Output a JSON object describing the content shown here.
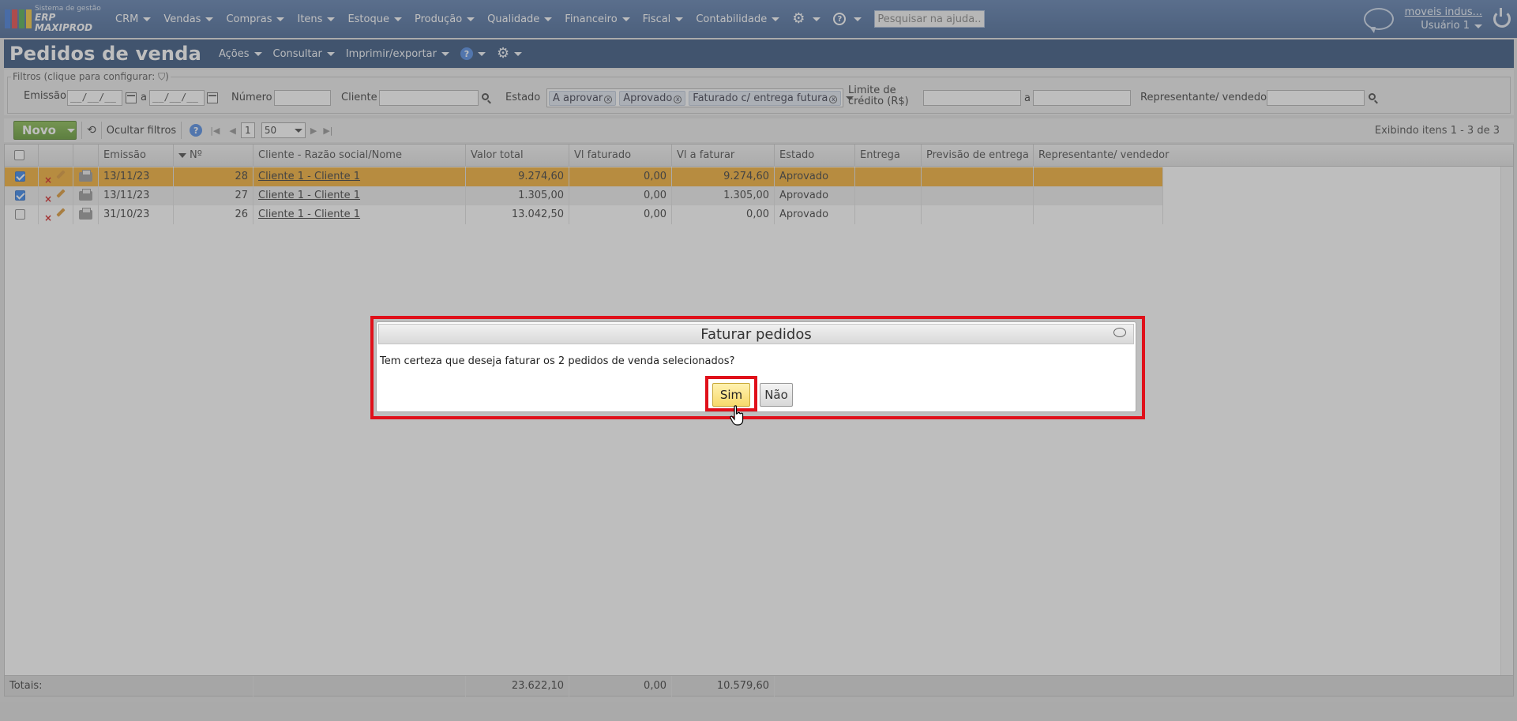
{
  "topbar": {
    "logo_line1": "Sistema de gestão",
    "logo_line2": "ERP MAXIPROD",
    "menu": [
      "CRM",
      "Vendas",
      "Compras",
      "Itens",
      "Estoque",
      "Produção",
      "Qualidade",
      "Financeiro",
      "Fiscal",
      "Contabilidade"
    ],
    "search_placeholder": "Pesquisar na ajuda...",
    "company": "moveis indus...",
    "user": "Usuário 1"
  },
  "page": {
    "title": "Pedidos de venda",
    "actions": [
      "Ações",
      "Consultar",
      "Imprimir/exportar"
    ]
  },
  "filters": {
    "legend": "Filtros (clique para configurar:",
    "emissao_label": "Emissão",
    "date_from": "__/__/__",
    "date_to": "__/__/__",
    "a_label": "a",
    "numero_label": "Número",
    "cliente_label": "Cliente",
    "estado_label": "Estado",
    "estado_tags": [
      "A aprovar",
      "Aprovado",
      "Faturado c/ entrega futura"
    ],
    "limite_label_1": "Limite de",
    "limite_label_2": "crédito (R$)",
    "limite_a": "a",
    "representante_label": "Representante/ vendedor"
  },
  "toolbar": {
    "novo": "Novo",
    "ocultar_filtros": "Ocultar filtros",
    "page": "1",
    "page_size": "50",
    "showing": "Exibindo itens 1 - 3 de 3"
  },
  "grid": {
    "columns": [
      "Emissão",
      "Nº",
      "Cliente - Razão social/Nome",
      "Valor total",
      "Vl faturado",
      "Vl a faturar",
      "Estado",
      "Entrega",
      "Previsão de entrega",
      "Representante/ vendedor"
    ],
    "rows": [
      {
        "checked": true,
        "emissao": "13/11/23",
        "numero": "28",
        "cliente": "Cliente 1 - Cliente 1",
        "valor_total": "9.274,60",
        "vl_faturado": "0,00",
        "vl_a_faturar": "9.274,60",
        "estado": "Aprovado",
        "entrega": "",
        "previsao": "",
        "representante": ""
      },
      {
        "checked": true,
        "emissao": "13/11/23",
        "numero": "27",
        "cliente": "Cliente 1 - Cliente 1",
        "valor_total": "1.305,00",
        "vl_faturado": "0,00",
        "vl_a_faturar": "1.305,00",
        "estado": "Aprovado",
        "entrega": "",
        "previsao": "",
        "representante": ""
      },
      {
        "checked": false,
        "emissao": "31/10/23",
        "numero": "26",
        "cliente": "Cliente 1 - Cliente 1",
        "valor_total": "13.042,50",
        "vl_faturado": "0,00",
        "vl_a_faturar": "0,00",
        "estado": "Aprovado",
        "entrega": "",
        "previsao": "",
        "representante": ""
      }
    ],
    "totals": {
      "label": "Totais:",
      "valor_total": "23.622,10",
      "vl_faturado": "0,00",
      "vl_a_faturar": "10.579,60"
    }
  },
  "dialog": {
    "title": "Faturar pedidos",
    "message": "Tem certeza que deseja faturar os 2 pedidos de venda selecionados?",
    "yes": "Sim",
    "no": "Não"
  },
  "colors": {
    "topbar": "#2f5387",
    "header": "#1d3f6e",
    "selected_row": "#f3a51a",
    "highlight": "#e0101a",
    "novo_button": "#5a9a22"
  }
}
